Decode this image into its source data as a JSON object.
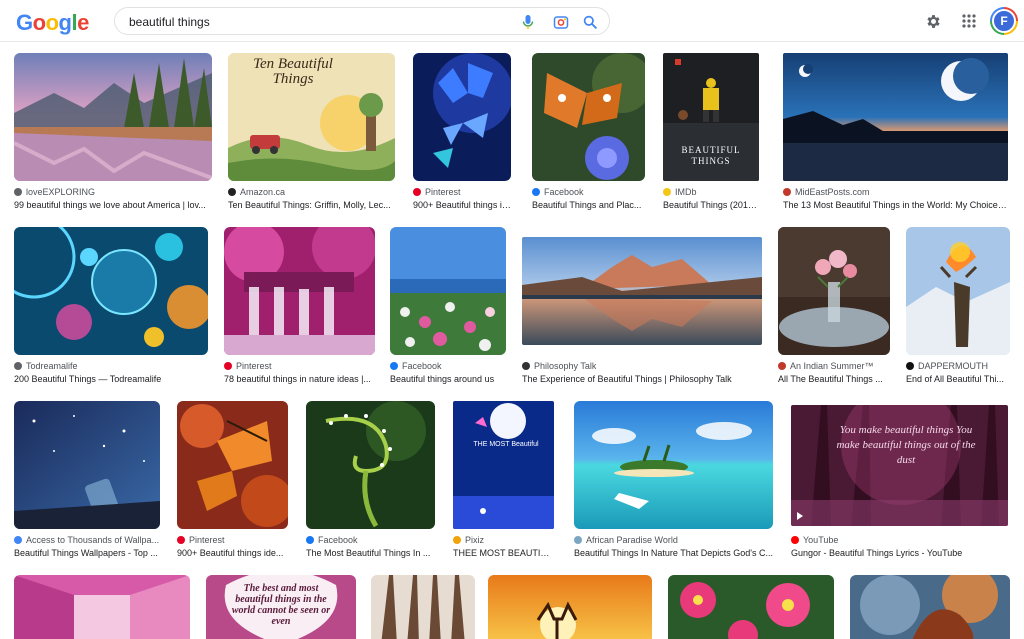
{
  "header": {
    "logo": "Google",
    "logo_colors": [
      "#4285f4",
      "#ea4335",
      "#fbbc05",
      "#4285f4",
      "#34a853",
      "#ea4335"
    ],
    "query": "beautiful things",
    "icons": {
      "mic": "mic-icon",
      "lens": "camera-lens-icon",
      "search": "search-icon",
      "settings": "gear-icon",
      "apps": "apps-grid-icon"
    },
    "avatar_letter": "F"
  },
  "results": [
    {
      "source": "loveEXPLORING",
      "title": "99 beautiful things we love about America | lov...",
      "favicon_color": "#5f6368"
    },
    {
      "source": "Amazon.ca",
      "title": "Ten Beautiful Things: Griffin, Molly, Lec...",
      "favicon_color": "#222222",
      "thumb_text": "Ten Beautiful Things"
    },
    {
      "source": "Pinterest",
      "title": "900+ Beautiful things id...",
      "favicon_color": "#e60023"
    },
    {
      "source": "Facebook",
      "title": "Beautiful Things and Plac...",
      "favicon_color": "#1877f2"
    },
    {
      "source": "IMDb",
      "title": "Beautiful Things (2017)...",
      "favicon_color": "#f5c518",
      "thumb_text": "BEAUTIFUL THINGS"
    },
    {
      "source": "MidEastPosts.com",
      "title": "The 13 Most Beautiful Things in the World: My Choice |...",
      "favicon_color": "#c0392b"
    },
    {
      "source": "Todreamalife",
      "title": "200 Beautiful Things — Todreamalife",
      "favicon_color": "#5f6368"
    },
    {
      "source": "Pinterest",
      "title": "78 beautiful things in nature ideas |...",
      "favicon_color": "#e60023"
    },
    {
      "source": "Facebook",
      "title": "Beautiful things around us",
      "favicon_color": "#1877f2"
    },
    {
      "source": "Philosophy Talk",
      "title": "The Experience of Beautiful Things | Philosophy Talk",
      "favicon_color": "#333333"
    },
    {
      "source": "An Indian Summer™",
      "title": "All The Beautiful Things ...",
      "favicon_color": "#c0392b"
    },
    {
      "source": "DAPPERMOUTH",
      "title": "End of All Beautiful Thi...",
      "favicon_color": "#111111"
    },
    {
      "source": "Access to Thousands of Wallpa...",
      "title": "Beautiful Things Wallpapers - Top ...",
      "favicon_color": "#4285f4"
    },
    {
      "source": "Pinterest",
      "title": "900+ Beautiful things ide...",
      "favicon_color": "#e60023"
    },
    {
      "source": "Facebook",
      "title": "The Most Beautiful Things In ...",
      "favicon_color": "#1877f2"
    },
    {
      "source": "Pixiz",
      "title": "THEE MOST BEAUTIFUL...",
      "favicon_color": "#f1a30b",
      "thumb_text": "THE MOST Beautiful"
    },
    {
      "source": "African Paradise World",
      "title": "Beautiful Things In Nature That Depicts God's C...",
      "favicon_color": "#7aa6c2"
    },
    {
      "source": "YouTube",
      "title": "Gungor - Beautiful Things Lyrics - YouTube",
      "favicon_color": "#ff0000",
      "thumb_text": "You make beautiful things You make beautiful things out of the dust"
    },
    {
      "thumb_text": "The best and most beautiful things in the world cannot be seen or even"
    }
  ]
}
